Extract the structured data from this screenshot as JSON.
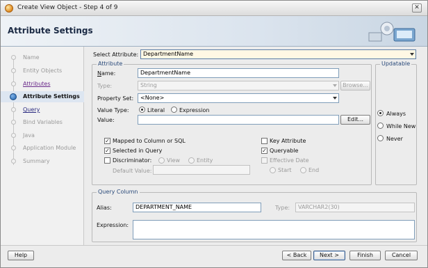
{
  "window": {
    "title": "Create View Object - Step 4 of 9",
    "close_glyph": "✕"
  },
  "banner": {
    "title": "Attribute Settings"
  },
  "nav": {
    "items": [
      {
        "label": "Name",
        "state": "disabled"
      },
      {
        "label": "Entity Objects",
        "state": "disabled"
      },
      {
        "label": "Attributes",
        "state": "visited"
      },
      {
        "label": "Attribute Settings",
        "state": "active"
      },
      {
        "label": "Query",
        "state": "link"
      },
      {
        "label": "Bind Variables",
        "state": "disabled"
      },
      {
        "label": "Java",
        "state": "disabled"
      },
      {
        "label": "Application Module",
        "state": "disabled"
      },
      {
        "label": "Summary",
        "state": "disabled"
      }
    ]
  },
  "form": {
    "select_attribute_label": "Select Attribute:",
    "select_attribute_value": "DepartmentName",
    "attribute_group_title": "Attribute",
    "name_label": "Name:",
    "name_value": "DepartmentName",
    "type_label": "Type:",
    "type_value": "String",
    "browse_label": "Browse...",
    "property_set_label": "Property Set:",
    "property_set_value": "<None>",
    "value_type_label": "Value Type:",
    "value_type_literal": "Literal",
    "value_type_expression": "Expression",
    "value_label": "Value:",
    "value_value": "",
    "edit_label": "Edit...",
    "mapped_label": "Mapped to Column or SQL",
    "selected_in_query_label": "Selected in Query",
    "discriminator_label": "Discriminator:",
    "disc_view": "View",
    "disc_entity": "Entity",
    "default_value_label": "Default Value:",
    "key_attribute_label": "Key Attribute",
    "queryable_label": "Queryable",
    "effective_date_label": "Effective Date",
    "eff_start": "Start",
    "eff_end": "End",
    "check_glyph": "✓"
  },
  "updatable": {
    "title": "Updatable",
    "always": "Always",
    "while_new": "While New",
    "never": "Never"
  },
  "query_column": {
    "title": "Query Column",
    "alias_label": "Alias:",
    "alias_value": "DEPARTMENT_NAME",
    "type_label": "Type:",
    "type_value": "VARCHAR2(30)",
    "expression_label": "Expression:"
  },
  "buttons": {
    "help": "Help",
    "back": "< Back",
    "next": "Next >",
    "finish": "Finish",
    "cancel": "Cancel"
  }
}
